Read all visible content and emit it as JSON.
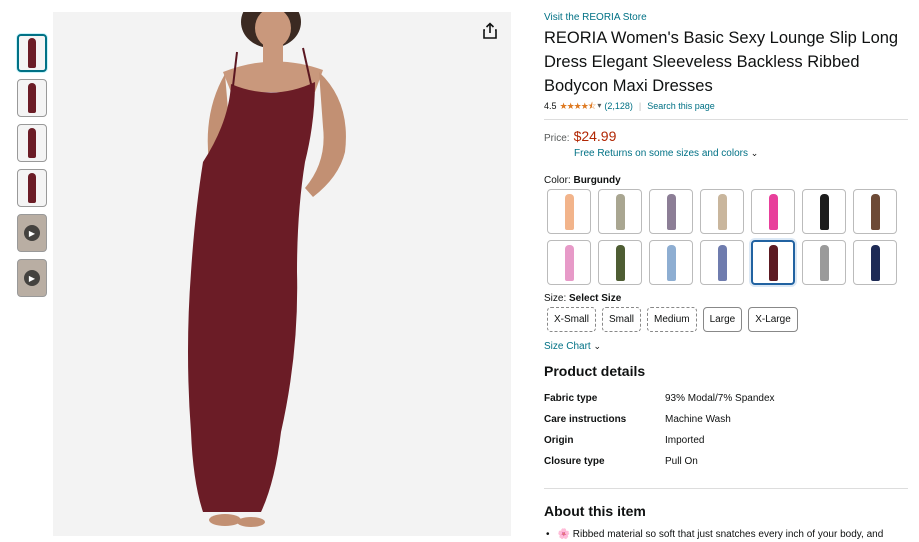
{
  "store_link": "Visit the REORIA Store",
  "title": "REORIA Women's Basic Sexy Lounge Slip Long Dress Elegant Sleeveless Backless Ribbed Bodycon Maxi Dresses",
  "rating": {
    "value": "4.5",
    "stars": "★★★★⯪",
    "count": "(2,128)",
    "separator": "|",
    "search_link": "Search this page"
  },
  "price": {
    "label": "Price:",
    "value": "$24.99",
    "returns": "Free Returns on some sizes and colors"
  },
  "color": {
    "label": "Color:",
    "selected": "Burgundy",
    "swatches": [
      {
        "color": "#f2b48b"
      },
      {
        "color": "#a9a691"
      },
      {
        "color": "#8c7e96"
      },
      {
        "color": "#c9b69d"
      },
      {
        "color": "#e83f9b"
      },
      {
        "color": "#1c1c1c"
      },
      {
        "color": "#6d4a36"
      },
      {
        "color": "#e79ac8"
      },
      {
        "color": "#4e5d33"
      },
      {
        "color": "#8eaed2"
      },
      {
        "color": "#6f7cae"
      },
      {
        "color": "#5c1a22",
        "selected": true
      },
      {
        "color": "#9a9a9a"
      },
      {
        "color": "#1d2a55"
      }
    ]
  },
  "size": {
    "label": "Size:",
    "selected": "Select Size",
    "options": [
      {
        "label": "X-Small",
        "available": false
      },
      {
        "label": "Small",
        "available": false
      },
      {
        "label": "Medium",
        "available": false
      },
      {
        "label": "Large",
        "available": true
      },
      {
        "label": "X-Large",
        "available": true
      }
    ],
    "chart_link": "Size Chart"
  },
  "product_details": {
    "heading": "Product details",
    "rows": [
      {
        "key": "Fabric type",
        "value": "93% Modal/7% Spandex"
      },
      {
        "key": "Care instructions",
        "value": "Machine Wash"
      },
      {
        "key": "Origin",
        "value": "Imported"
      },
      {
        "key": "Closure type",
        "value": "Pull On"
      }
    ]
  },
  "about": {
    "heading": "About this item",
    "bullets": [
      "🌸 Ribbed material so soft that just snatches every inch of your body, and"
    ]
  },
  "colors": {
    "link": "#007185",
    "price": "#b12704",
    "star": "#de7921",
    "dress": "#6b1c26"
  },
  "icons": [
    "share-icon",
    "chevron-down-icon",
    "play-icon"
  ]
}
